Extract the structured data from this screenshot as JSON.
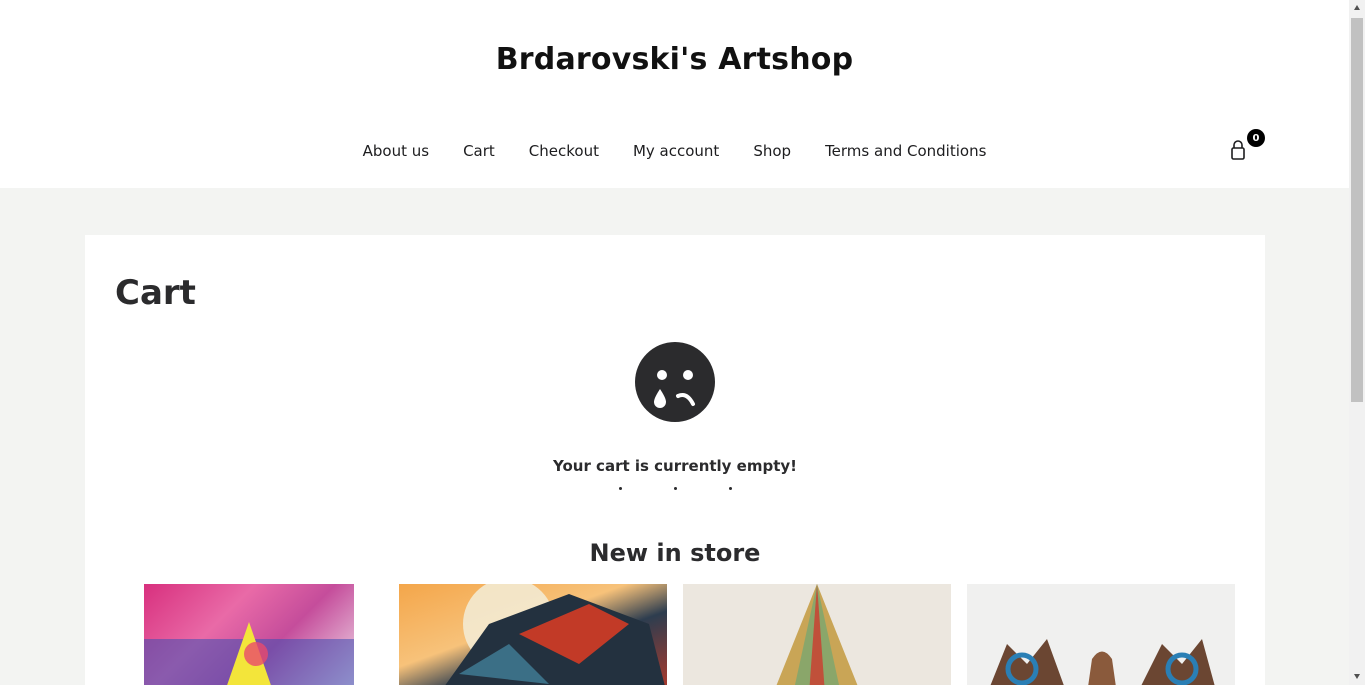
{
  "header": {
    "site_title": "Brdarovski's Artshop",
    "cart_count": "0"
  },
  "nav": {
    "items": [
      {
        "label": "About us"
      },
      {
        "label": "Cart"
      },
      {
        "label": "Checkout"
      },
      {
        "label": "My account"
      },
      {
        "label": "Shop"
      },
      {
        "label": "Terms and Conditions"
      }
    ]
  },
  "cart_page": {
    "title": "Cart",
    "empty_message": "Your cart is currently empty!",
    "new_in_store_title": "New in store"
  },
  "colors": {
    "accent": "#2b2b2d",
    "page_background": "#f3f4f2",
    "header_background": "#ffffff"
  },
  "icons": {
    "cart": "shopping-bag-icon",
    "empty_cart": "sad-face-icon"
  }
}
